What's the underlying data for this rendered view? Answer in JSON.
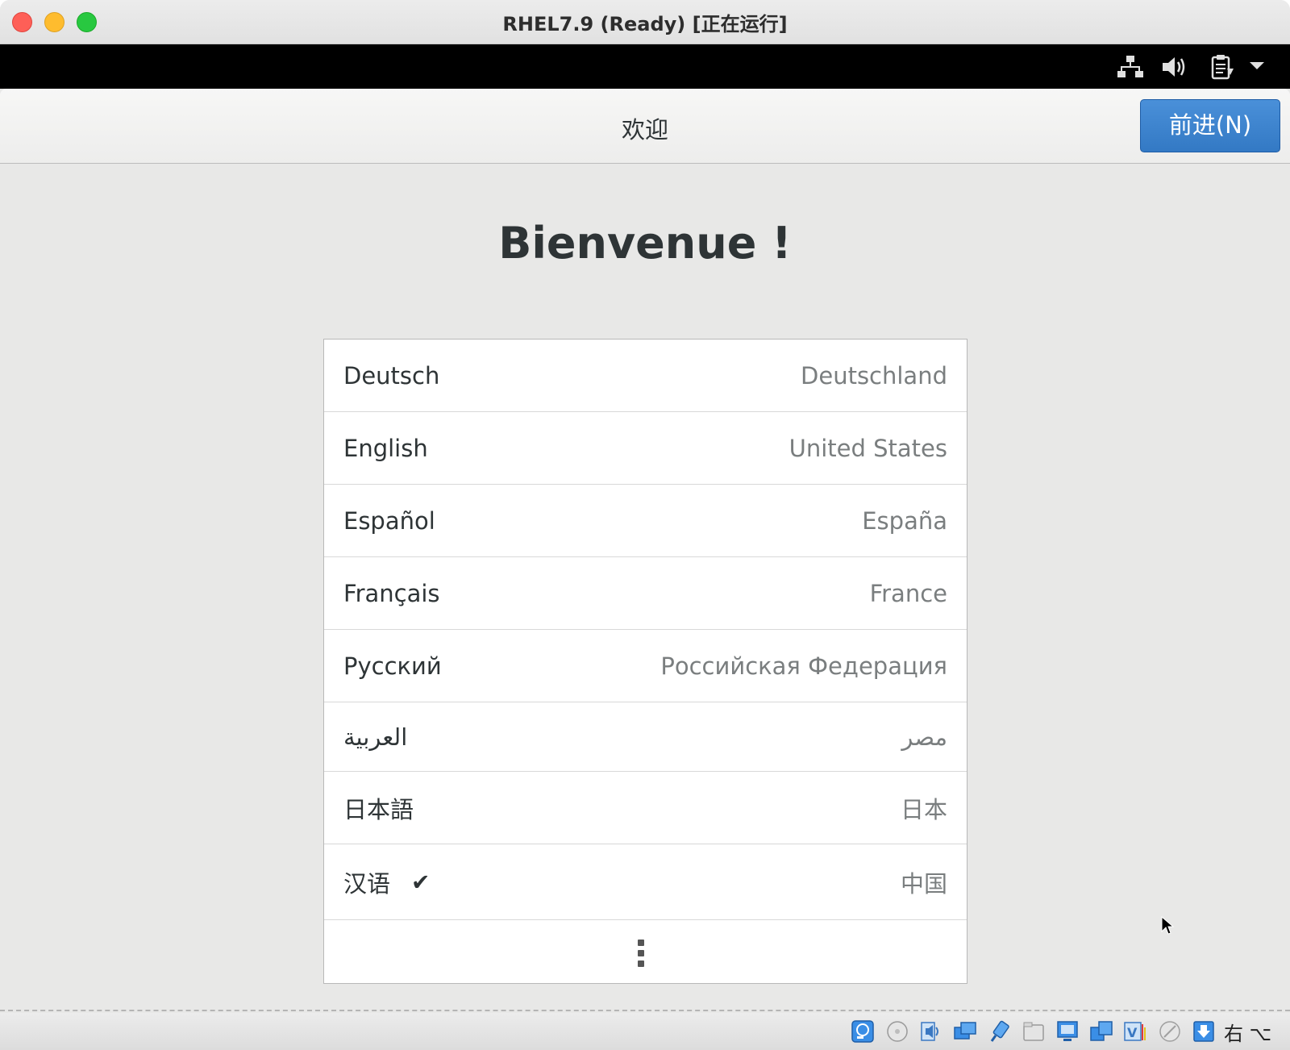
{
  "window": {
    "title": "RHEL7.9 (Ready) [正在运行]"
  },
  "guest_topbar": {
    "icons": [
      "network-icon",
      "volume-icon",
      "clipboard-icon",
      "dropdown-arrow-icon"
    ]
  },
  "header": {
    "title": "欢迎",
    "next_label": "前进(N)"
  },
  "main": {
    "heading": "Bienvenue !",
    "languages": [
      {
        "name": "Deutsch",
        "region": "Deutschland",
        "selected": false
      },
      {
        "name": "English",
        "region": "United States",
        "selected": false
      },
      {
        "name": "Español",
        "region": "España",
        "selected": false
      },
      {
        "name": "Français",
        "region": "France",
        "selected": false
      },
      {
        "name": "Русский",
        "region": "Российская Федерация",
        "selected": false
      },
      {
        "name": "العربية",
        "region": "مصر",
        "selected": false
      },
      {
        "name": "日本語",
        "region": "日本",
        "selected": false
      },
      {
        "name": "汉语",
        "region": "中国",
        "selected": true
      }
    ],
    "check_glyph": "✔",
    "more_icon": "vertical-ellipsis-icon"
  },
  "status_bar": {
    "icons": [
      "hard-disk-icon",
      "optical-drive-icon",
      "audio-icon",
      "network-adapter-icon",
      "usb-icon",
      "shared-folder-icon",
      "display-icon",
      "screen-capture-icon",
      "video-capture-icon",
      "mouse-integration-icon",
      "keyboard-capture-icon"
    ],
    "host_key": "右 ⌥"
  },
  "colors": {
    "accent": "#3b84d0",
    "window_bg": "#e8e8e7",
    "traffic_close": "#fe5f57",
    "traffic_min": "#febc2e",
    "traffic_max": "#28c840"
  }
}
